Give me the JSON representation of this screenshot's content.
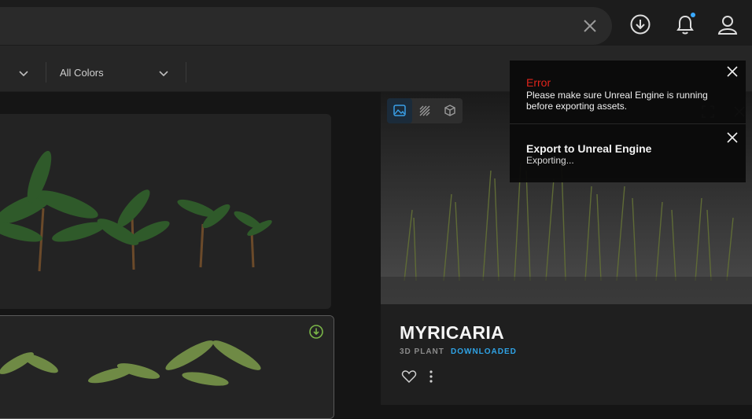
{
  "search": {
    "value": ""
  },
  "filters": {
    "color_select": "All Colors"
  },
  "detail": {
    "title": "MYRICARIA",
    "type": "3D PLANT",
    "status": "DOWNLOADED"
  },
  "toasts": [
    {
      "title": "Error",
      "message": "Please make sure Unreal Engine is running before exporting assets."
    },
    {
      "title": "Export to Unreal Engine",
      "message": "Exporting..."
    }
  ],
  "colors": {
    "accent": "#2fa3e6",
    "error": "#e0241b",
    "download_badge": "#7ab648",
    "notification_dot": "#3aa9ff"
  },
  "icons": [
    "clear-icon",
    "download-icon",
    "bell-icon",
    "user-icon",
    "chevron-down-icon",
    "image-view-icon",
    "texture-view-icon",
    "3d-view-icon",
    "heart-icon",
    "more-icon",
    "expand-icon",
    "close-icon"
  ]
}
